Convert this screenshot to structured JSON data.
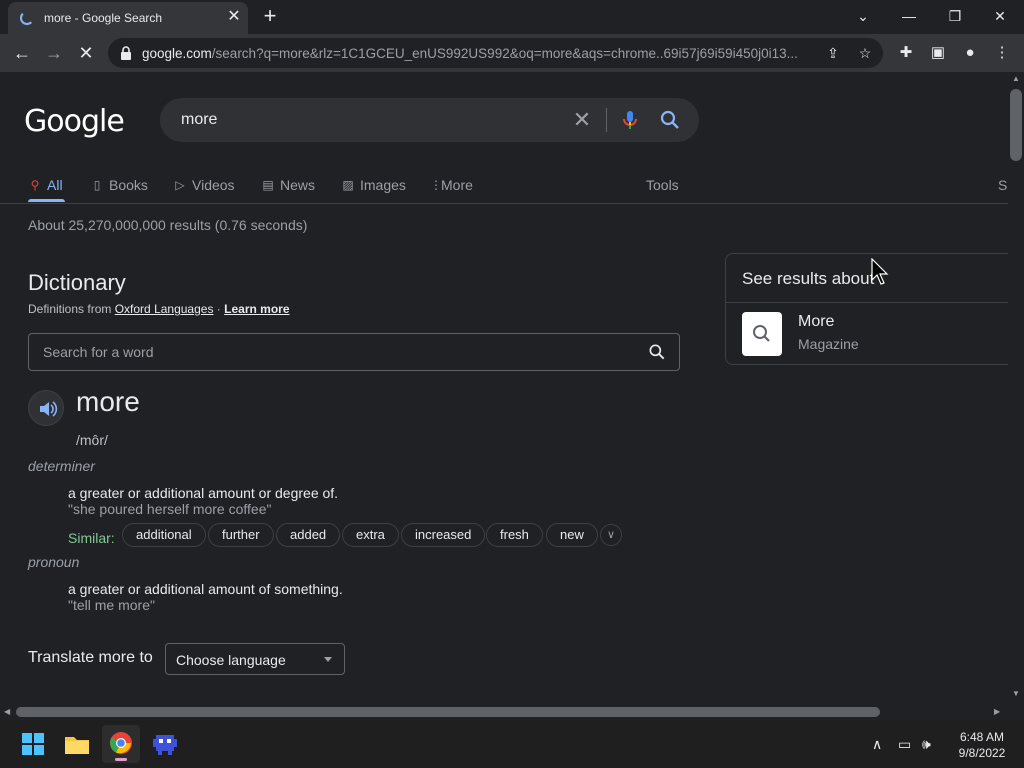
{
  "browser": {
    "tab_title": "more - Google Search",
    "url_host": "google.com",
    "url_rest": "/search?q=more&rlz=1C1GCEU_enUS992US992&oq=more&aqs=chrome..69i57j69i59i450j0i13..."
  },
  "search": {
    "logo": "Google",
    "query": "more"
  },
  "navtabs": {
    "all": "All",
    "books": "Books",
    "videos": "Videos",
    "news": "News",
    "images": "Images",
    "more": "More",
    "tools": "Tools",
    "s": "S"
  },
  "stats": "About 25,270,000,000 results (0.76 seconds)",
  "dictionary": {
    "title": "Dictionary",
    "source_prefix": "Definitions from",
    "source_link": "Oxford Languages",
    "source_sep": " · ",
    "learn_more": "Learn more",
    "search_placeholder": "Search for a word",
    "word": "more",
    "phonetic": "/môr/",
    "entries": [
      {
        "pos": "determiner",
        "definition": "a greater or additional amount or degree of.",
        "example": "\"she poured herself more coffee\""
      },
      {
        "pos": "pronoun",
        "definition": "a greater or additional amount of something.",
        "example": "\"tell me more\""
      }
    ],
    "similar_label": "Similar:",
    "similar": [
      "additional",
      "further",
      "added",
      "extra",
      "increased",
      "fresh",
      "new"
    ]
  },
  "translate": {
    "label": "Translate more to",
    "select_value": "Choose language"
  },
  "side_panel": {
    "title": "See results about",
    "item_name": "More",
    "item_sub": "Magazine"
  },
  "taskbar": {
    "time": "6:48 AM",
    "date": "9/8/2022"
  },
  "colors": {
    "accent_blue": "#8ab4f8",
    "similar_green": "#81c995",
    "background": "#202124"
  }
}
